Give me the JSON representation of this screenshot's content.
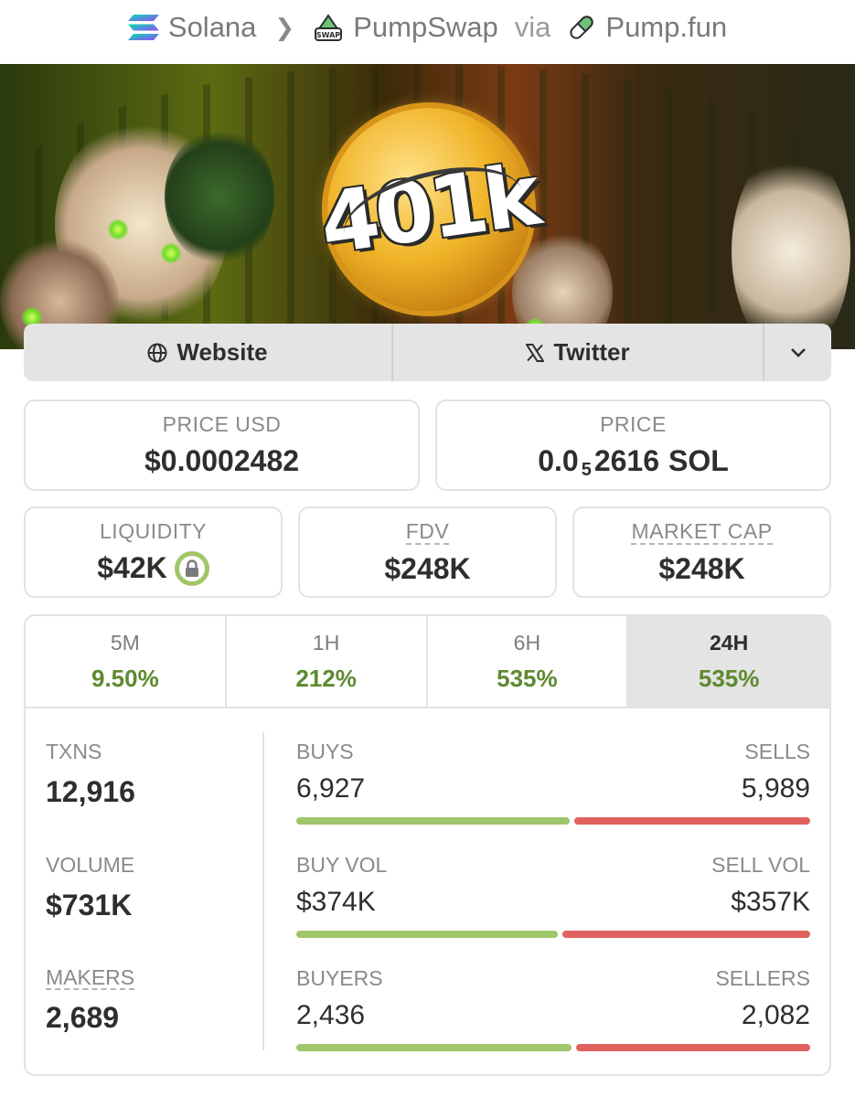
{
  "breadcrumb": {
    "chain": "Solana",
    "dex": "PumpSwap",
    "dex_badge": "SWAP",
    "via": "via",
    "launchpad": "Pump.fun"
  },
  "banner": {
    "coin_text": "401k"
  },
  "links": {
    "website": "Website",
    "twitter": "Twitter",
    "more_icon": "chevron-down-icon"
  },
  "price": {
    "usd_label": "PRICE USD",
    "usd_value": "$0.0002482",
    "native_label": "PRICE",
    "native_prefix": "0.0",
    "native_zeros": "5",
    "native_digits": "2616",
    "native_unit": "SOL"
  },
  "metrics": {
    "liquidity_label": "LIQUIDITY",
    "liquidity_value": "$42K",
    "fdv_label": "FDV",
    "fdv_value": "$248K",
    "mcap_label": "MARKET CAP",
    "mcap_value": "$248K"
  },
  "timeframes": [
    {
      "label": "5M",
      "change": "9.50%"
    },
    {
      "label": "1H",
      "change": "212%"
    },
    {
      "label": "6H",
      "change": "535%"
    },
    {
      "label": "24H",
      "change": "535%"
    }
  ],
  "selected_timeframe": "24H",
  "stats": {
    "txns_label": "TXNS",
    "txns_value": "12,916",
    "volume_label": "VOLUME",
    "volume_value": "$731K",
    "makers_label": "MAKERS",
    "makers_value": "2,689",
    "buys_label": "BUYS",
    "buys_value": "6,927",
    "sells_label": "SELLS",
    "sells_value": "5,989",
    "buys_fraction": 0.536,
    "buy_vol_label": "BUY VOL",
    "buy_vol_value": "$374K",
    "sell_vol_label": "SELL VOL",
    "sell_vol_value": "$357K",
    "buy_vol_fraction": 0.512,
    "buyers_label": "BUYERS",
    "buyers_value": "2,436",
    "sellers_label": "SELLERS",
    "sellers_value": "2,082",
    "buyers_fraction": 0.539
  },
  "colors": {
    "positive": "#5d8a2e",
    "buy_bar": "#9fc66a",
    "sell_bar": "#e0625e",
    "tab_active_bg": "#e4e4e4"
  }
}
